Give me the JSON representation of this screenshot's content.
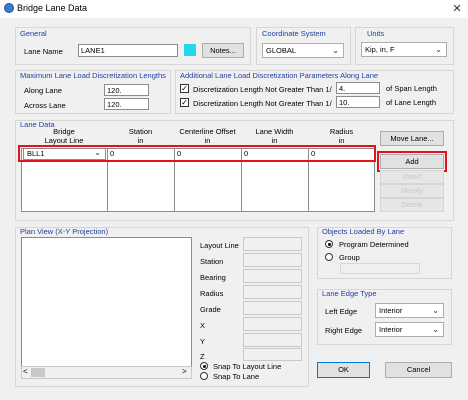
{
  "window": {
    "title": "Bridge Lane Data",
    "close": "✕"
  },
  "general": {
    "group_title": "General",
    "lane_name_label": "Lane Name",
    "lane_name_value": "LANE1",
    "swatch_color": "#25d7ec",
    "notes_button": "Notes..."
  },
  "coord": {
    "group_title": "Coordinate System",
    "value": "GLOBAL"
  },
  "units": {
    "group_title": "Units",
    "value": "Kip, in, F"
  },
  "disc": {
    "group_title": "Maximum Lane Load Discretization Lengths",
    "along_label": "Along Lane",
    "along_value": "120.",
    "across_label": "Across Lane",
    "across_value": "120."
  },
  "params": {
    "group_title": "Additional Lane Load Discretization Parameters Along Lane",
    "row1_label": "Discretization Length Not Greater Than  1/",
    "row1_value": "4.",
    "row1_suffix": "of Span Length",
    "row2_label": "Discretization Length Not Greater Than  1/",
    "row2_value": "10.",
    "row2_suffix": "of Lane Length"
  },
  "lane": {
    "group_title": "Lane Data",
    "headers": [
      {
        "line1": "Bridge",
        "line2": "Layout Line"
      },
      {
        "line1": "Station",
        "line2": "in"
      },
      {
        "line1": "Centerline Offset",
        "line2": "in"
      },
      {
        "line1": "Lane Width",
        "line2": "in"
      },
      {
        "line1": "Radius",
        "line2": "in"
      }
    ],
    "row": {
      "layout_line": "BLL1",
      "station": "0",
      "offset": "0",
      "width": "0",
      "radius": "0"
    },
    "info_icon": "i",
    "buttons": {
      "move": "Move Lane...",
      "add": "Add",
      "insert": "Insert",
      "modify": "Modify",
      "delete": "Delete"
    }
  },
  "plan": {
    "group_title": "Plan View (X-Y Projection)",
    "fields": {
      "layout_line": "Layout Line",
      "station": "Station",
      "bearing": "Bearing",
      "radius": "Radius",
      "grade": "Grade",
      "x": "X",
      "y": "Y",
      "z": "Z"
    },
    "snap_layout": "Snap To Layout Line",
    "snap_lane": "Snap To Lane"
  },
  "objects": {
    "group_title": "Objects Loaded By Lane",
    "program": "Program Determined",
    "group": "Group"
  },
  "edge": {
    "group_title": "Lane Edge Type",
    "left_label": "Left Edge",
    "left_value": "Interior",
    "right_label": "Right Edge",
    "right_value": "Interior"
  },
  "dialog": {
    "ok": "OK",
    "cancel": "Cancel"
  }
}
